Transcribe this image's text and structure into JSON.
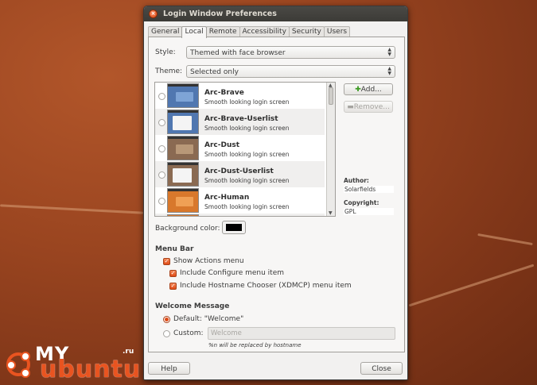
{
  "window": {
    "title": "Login Window Preferences"
  },
  "tabs": [
    "General",
    "Local",
    "Remote",
    "Accessibility",
    "Security",
    "Users"
  ],
  "style": {
    "label": "Style:",
    "value": "Themed with face browser"
  },
  "theme": {
    "label": "Theme:",
    "value": "Selected only"
  },
  "themes": [
    {
      "name": "Arc-Brave",
      "desc": "Smooth looking login screen"
    },
    {
      "name": "Arc-Brave-Userlist",
      "desc": "Smooth looking login screen"
    },
    {
      "name": "Arc-Dust",
      "desc": "Smooth looking login screen"
    },
    {
      "name": "Arc-Dust-Userlist",
      "desc": "Smooth looking login screen"
    },
    {
      "name": "Arc-Human",
      "desc": "Smooth looking login screen"
    }
  ],
  "buttons": {
    "add": "Add...",
    "remove": "Remove..."
  },
  "info": {
    "author_label": "Author:",
    "author": "Solarfields",
    "copyright_label": "Copyright:",
    "copyright": "GPL"
  },
  "background": {
    "label": "Background color:",
    "color": "#000000"
  },
  "menu_bar": {
    "title": "Menu Bar",
    "show_actions": "Show Actions menu",
    "configure_item": "Include Configure menu item",
    "hostname_item": "Include Hostname Chooser (XDMCP) menu item"
  },
  "welcome": {
    "title": "Welcome Message",
    "default_label": "Default: \"Welcome\"",
    "custom_label": "Custom:",
    "custom_placeholder": "Welcome",
    "hint": "%n will be replaced by hostname"
  },
  "footer": {
    "help": "Help",
    "close": "Close"
  },
  "watermark": {
    "my": "MY",
    "ubuntu": "ubuntu",
    "ru": ".ru"
  }
}
